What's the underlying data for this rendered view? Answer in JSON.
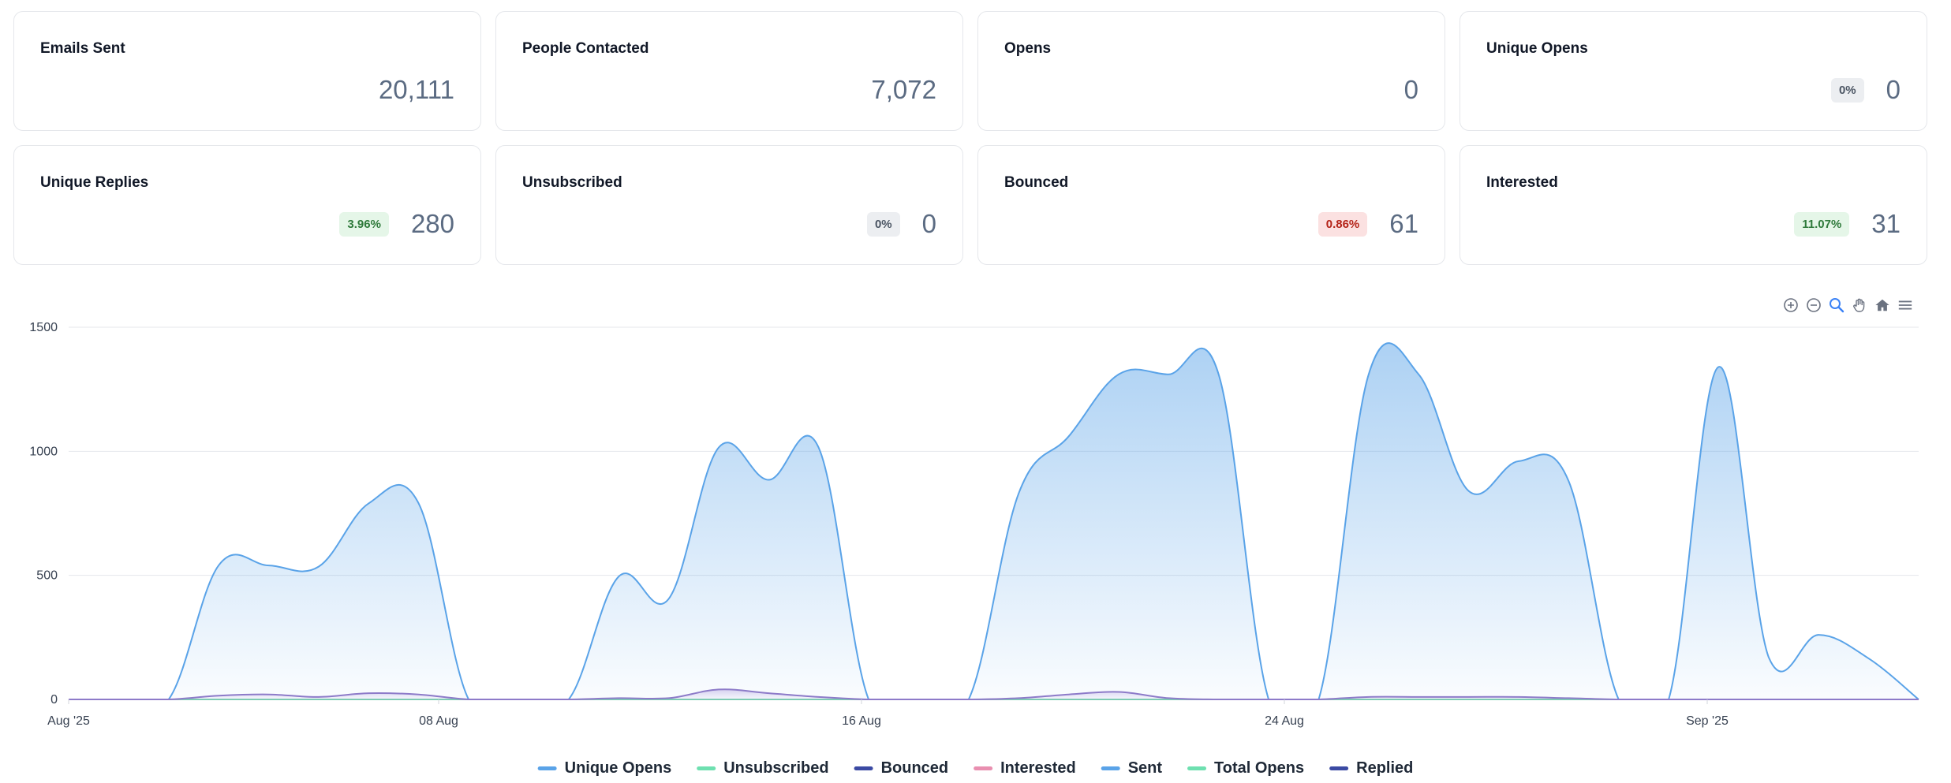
{
  "cards": [
    {
      "title": "Emails Sent",
      "value": "20,111",
      "badge": null,
      "badge_tone": null
    },
    {
      "title": "People Contacted",
      "value": "7,072",
      "badge": null,
      "badge_tone": null
    },
    {
      "title": "Opens",
      "value": "0",
      "badge": null,
      "badge_tone": null
    },
    {
      "title": "Unique Opens",
      "value": "0",
      "badge": "0%",
      "badge_tone": "neutral"
    },
    {
      "title": "Unique Replies",
      "value": "280",
      "badge": "3.96%",
      "badge_tone": "green"
    },
    {
      "title": "Unsubscribed",
      "value": "0",
      "badge": "0%",
      "badge_tone": "neutral"
    },
    {
      "title": "Bounced",
      "value": "61",
      "badge": "0.86%",
      "badge_tone": "red"
    },
    {
      "title": "Interested",
      "value": "31",
      "badge": "11.07%",
      "badge_tone": "green"
    }
  ],
  "toolbar": {
    "icons": [
      "zoom-in-icon",
      "zoom-out-icon",
      "zoom-select-icon",
      "pan-hand-icon",
      "reset-home-icon",
      "menu-icon"
    ]
  },
  "chart_data": {
    "type": "area",
    "title": "",
    "xlabel": "",
    "ylabel": "",
    "ylim": [
      0,
      1500
    ],
    "yticks": [
      0,
      500,
      1000,
      1500
    ],
    "x_tick_labels": [
      "Aug '25",
      "08 Aug",
      "16 Aug",
      "24 Aug",
      "Sep '25"
    ],
    "x_tick_days": [
      0,
      7,
      15,
      23,
      31
    ],
    "grid": true,
    "legend_position": "bottom-center",
    "x_days": [
      0,
      1,
      2,
      3,
      4,
      5,
      6,
      7,
      8,
      9,
      10,
      11,
      12,
      13,
      14,
      15,
      16,
      17,
      18,
      19,
      20,
      21,
      22,
      23,
      24,
      25,
      26,
      27,
      28,
      29,
      30,
      31,
      32,
      33,
      34,
      35
    ],
    "series": [
      {
        "name": "Unique Opens",
        "color": "#5aa3e8",
        "values": [
          0,
          0,
          0,
          0,
          0,
          0,
          0,
          0,
          0,
          0,
          0,
          0,
          0,
          0,
          0,
          0,
          0,
          0,
          0,
          0,
          0,
          0,
          0,
          0,
          0,
          0,
          0,
          0,
          0,
          0,
          0,
          0,
          0,
          0,
          0,
          0
        ]
      },
      {
        "name": "Unsubscribed",
        "color": "#6ee0b0",
        "values": [
          0,
          0,
          0,
          0,
          0,
          0,
          0,
          0,
          0,
          0,
          0,
          0,
          0,
          0,
          0,
          0,
          0,
          0,
          0,
          0,
          0,
          0,
          0,
          0,
          0,
          0,
          0,
          0,
          0,
          0,
          0,
          0,
          0,
          0,
          0,
          0
        ]
      },
      {
        "name": "Bounced",
        "color": "#3b4aa3",
        "values": [
          0,
          0,
          0,
          0,
          0,
          0,
          0,
          0,
          0,
          0,
          0,
          0,
          0,
          0,
          0,
          0,
          0,
          0,
          0,
          0,
          0,
          0,
          0,
          0,
          0,
          0,
          0,
          0,
          0,
          0,
          0,
          0,
          0,
          0,
          0,
          0
        ]
      },
      {
        "name": "Interested",
        "color": "#e98fb0",
        "values": [
          0,
          0,
          0,
          0,
          0,
          0,
          0,
          0,
          0,
          0,
          0,
          0,
          0,
          0,
          0,
          0,
          0,
          0,
          0,
          0,
          0,
          0,
          0,
          0,
          0,
          0,
          0,
          0,
          0,
          0,
          0,
          0,
          0,
          0,
          0,
          0
        ]
      },
      {
        "name": "Sent",
        "color": "#5aa3e8",
        "values": [
          0,
          0,
          0,
          540,
          540,
          535,
          790,
          790,
          0,
          0,
          0,
          495,
          405,
          1015,
          885,
          1015,
          0,
          0,
          0,
          830,
          1060,
          1310,
          1310,
          1310,
          0,
          0,
          1310,
          1310,
          840,
          960,
          880,
          0,
          0,
          1340,
          170,
          260,
          165,
          0
        ]
      },
      {
        "name": "Total Opens",
        "color": "#6ee0b0",
        "values": [
          0,
          0,
          0,
          0,
          0,
          0,
          0,
          0,
          0,
          0,
          0,
          0,
          0,
          0,
          0,
          0,
          0,
          0,
          0,
          0,
          0,
          0,
          0,
          0,
          0,
          0,
          0,
          0,
          0,
          0,
          0,
          0,
          0,
          0,
          0,
          0
        ]
      },
      {
        "name": "Replied",
        "color": "#3b4aa3",
        "values": [
          0,
          0,
          0,
          15,
          20,
          10,
          25,
          20,
          0,
          0,
          0,
          5,
          5,
          40,
          25,
          10,
          0,
          0,
          0,
          5,
          20,
          30,
          5,
          0,
          0,
          0,
          10,
          10,
          10,
          10,
          5,
          0,
          0,
          0,
          0,
          0,
          0,
          0
        ]
      }
    ]
  }
}
